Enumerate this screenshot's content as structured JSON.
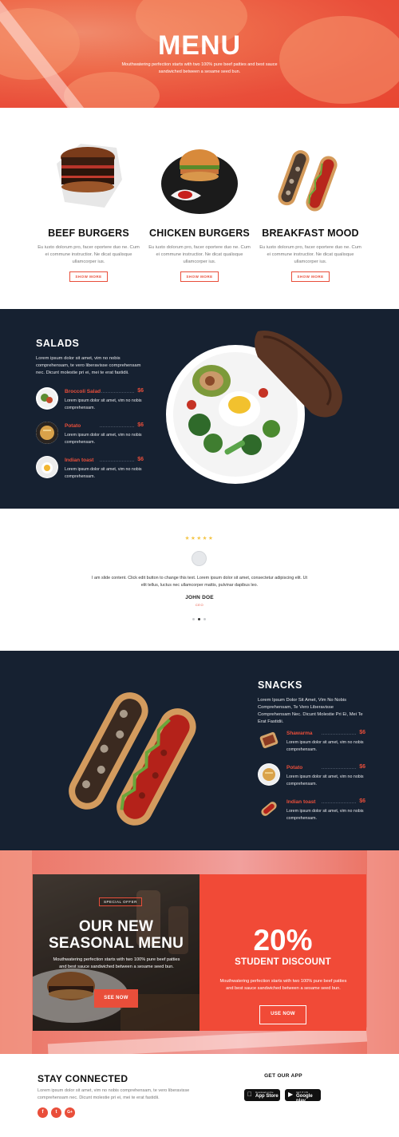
{
  "hero": {
    "title": "MENU",
    "subtitle": "Mouthwatering perfection starts with two 100% pure beef patties and best sauce sandwiched between a sesame seed bun."
  },
  "features": [
    {
      "title": "BEEF BURGERS",
      "desc": "Eu iusto dolorum pro, facer oportere duo ne. Cum ei commune instructior. Ne dicat qualisque ullamcorper ius.",
      "button": "SHOW MORE"
    },
    {
      "title": "CHICKEN BURGERS",
      "desc": "Eu iusto dolorum pro, facer oportere duo ne. Cum ei commune instructior. Ne dicat qualisque ullamcorper ius.",
      "button": "SHOW MORE"
    },
    {
      "title": "BREAKFAST MOOD",
      "desc": "Eu iusto dolorum pro, facer oportere duo ne. Cum ei commune instructior. Ne dicat qualisque ullamcorper ius.",
      "button": "SHOW MORE"
    }
  ],
  "salads": {
    "title": "SALADS",
    "desc": "Lorem ipsum dolor sit amet, vim no nobis comprehensam, te vero liberavisse comprehensam nec. Dicunt molestie pri ei, mei te erat fastidii.",
    "items": [
      {
        "name": "Broccoli Salad",
        "price": "$6",
        "desc": "Lorem ipsum dolor sit amet, vim no nobis comprehensam."
      },
      {
        "name": "Potato",
        "price": "$6",
        "desc": "Lorem ipsum dolor sit amet, vim no nobis comprehensam."
      },
      {
        "name": "Indian toast",
        "price": "$6",
        "desc": "Lorem ipsum dolor sit amet, vim no nobis comprehensam."
      }
    ]
  },
  "testimonial": {
    "stars": "★★★★★",
    "text": "I am slide content. Click edit button to change this text. Lorem ipsum dolor sit amet, consectetur adipiscing elit. Ut elit tellus, luctus nec ullamcorper mattis, pulvinar dapibus leo.",
    "name": "JOHN DOE",
    "role": "CEO",
    "active_slide": 2,
    "slide_count": 3
  },
  "snacks": {
    "title": "SNACKS",
    "desc": "Lorem Ipsum Dolor Sit Amet, Vim No Nobis Comprehensam, Te Vero Liberavisse Comprehensam Nec. Dicunt Molestie Pri Ei, Mei Te Erat Fastidii.",
    "items": [
      {
        "name": "Shawarma",
        "price": "$6",
        "desc": "Lorem ipsum dolor sit amet, vim no nobis comprehensam."
      },
      {
        "name": "Potato",
        "price": "$6",
        "desc": "Lorem ipsum dolor sit amet, vim no nobis comprehensam."
      },
      {
        "name": "Indian toast",
        "price": "$6",
        "desc": "Lorem ipsum dolor sit amet, vim no nobis comprehensam."
      }
    ]
  },
  "promo": {
    "tag": "SPECIAL OFFER",
    "title_line1": "OUR NEW",
    "title_line2": "SEASONAL MENU",
    "desc": "Mouthwatering perfection starts with two 100% pure beef patties and best sauce sandwiched between a sesame seed bun.",
    "button": "SEE NOW",
    "discount": "20%",
    "discount_label": "STUDENT DISCOUNT",
    "discount_desc": "Mouthwatering perfection starts with two 100% pure beef patties and best sauce sandwiched between a sesame seed bun.",
    "discount_button": "USE NOW"
  },
  "footer": {
    "title": "STAY CONNECTED",
    "desc": "Lorem ipsum dolor sit amet, vim no nobis comprehensam, te vero liberavisse comprehensam nec. Dicunt molestie pri ei, mei te erat fastidii.",
    "socials": [
      "f",
      "t",
      "G+"
    ],
    "get_app": "GET OUR APP",
    "app_store_small": "Download on the",
    "app_store": "App Store",
    "google_play_small": "GET IT ON",
    "google_play": "Google play"
  },
  "colors": {
    "accent": "#e94e3a",
    "navy": "#162131",
    "star": "#f4c443"
  }
}
